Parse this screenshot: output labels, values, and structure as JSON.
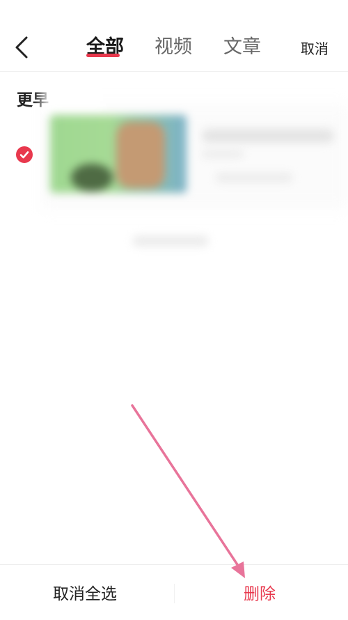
{
  "header": {
    "tabs": [
      {
        "label": "全部",
        "active": true
      },
      {
        "label": "视频",
        "active": false
      },
      {
        "label": "文章",
        "active": false
      }
    ],
    "cancel_label": "取消"
  },
  "list": {
    "section_label": "更早"
  },
  "footer": {
    "deselect_all_label": "取消全选",
    "delete_label": "删除"
  },
  "colors": {
    "accent": "#e8384d",
    "arrow": "#e8749a"
  }
}
